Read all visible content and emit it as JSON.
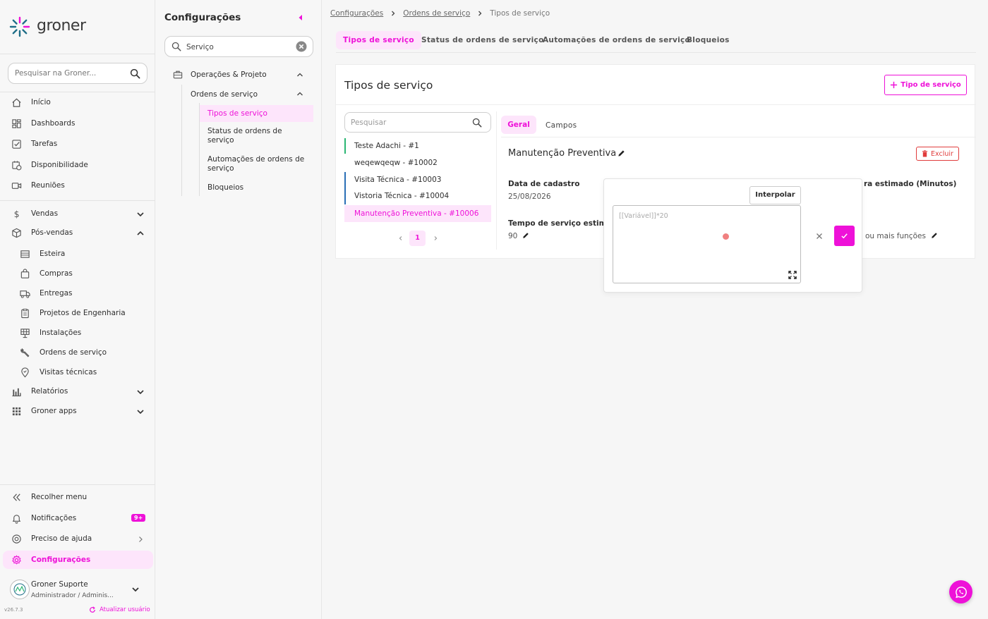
{
  "app": {
    "logo_text": "groner",
    "version": "v26.7.3"
  },
  "colors": {
    "accent": "#ee11d8",
    "accent_light": "#fde5fb",
    "sidebar_bg": "#f7f7f7",
    "danger": "#e03c3c"
  },
  "sidebar": {
    "search_placeholder": "Pesquisar na Groner...",
    "items": [
      {
        "label": "Início",
        "icon": "home-icon"
      },
      {
        "label": "Dashboards",
        "icon": "dashboard-icon"
      },
      {
        "label": "Tarefas",
        "icon": "checkbox-icon"
      },
      {
        "label": "Disponibilidade",
        "icon": "calendar-clock-icon"
      },
      {
        "label": "Reuniões",
        "icon": "video-icon"
      },
      {
        "label": "Vendas",
        "icon": "dollar-icon"
      },
      {
        "label": "Pós-vendas",
        "icon": "box-icon"
      },
      {
        "label": "Esteira",
        "icon": "list-icon"
      },
      {
        "label": "Compras",
        "icon": "shopping-bag-icon"
      },
      {
        "label": "Entregas",
        "icon": "truck-icon"
      },
      {
        "label": "Projetos de Engenharia",
        "icon": "clipboard-icon"
      },
      {
        "label": "Instalações",
        "icon": "solar-panel-icon"
      },
      {
        "label": "Ordens de serviço",
        "icon": "wrench-icon"
      },
      {
        "label": "Visitas técnicas",
        "icon": "location-pin-icon"
      },
      {
        "label": "Relatórios",
        "icon": "bar-chart-icon"
      },
      {
        "label": "Groner apps",
        "icon": "grid-icon"
      }
    ],
    "bottom": {
      "collapse": "Recolher menu",
      "notifications": "Notificações",
      "notifications_badge": "9+",
      "help": "Preciso de ajuda",
      "settings": "Configurações"
    },
    "user": {
      "name": "Groner Suporte",
      "role": "Administrador / Adminis...",
      "update_link": "Atualizar usuário"
    }
  },
  "settings_panel": {
    "title": "Configurações",
    "search_value": "Serviço",
    "tree": {
      "group": "Operações & Projeto",
      "subgroup": "Ordens de serviço",
      "items": [
        "Tipos de serviço",
        "Status de ordens de serviço",
        "Automações de ordens de serviço",
        "Bloqueios"
      ]
    }
  },
  "breadcrumb": [
    "Configurações",
    "Ordens de serviço",
    "Tipos de serviço"
  ],
  "tabs": [
    "Tipos de serviço",
    "Status de ordens de serviço",
    "Automações de ordens de serviço",
    "Bloqueios"
  ],
  "content": {
    "title": "Tipos de serviço",
    "add_button": "Tipo de serviço",
    "list_search_placeholder": "Pesquisar",
    "list": [
      {
        "label": "Teste Adachi - #1",
        "bar": "#2ab673"
      },
      {
        "label": "weqewqeqw - #10002",
        "bar": ""
      },
      {
        "label": "Visita Técnica - #10003",
        "bar": "#2a6fb6"
      },
      {
        "label": "Vistoria Técnica - #10004",
        "bar": "#2a6fb6"
      },
      {
        "label": "Manutenção Preventiva - #10006",
        "bar": ""
      }
    ],
    "pagination": {
      "current": "1"
    },
    "detail_tabs": [
      "Geral",
      "Campos"
    ],
    "detail_title": "Manutenção Preventiva",
    "delete_button": "Excluir",
    "fields": {
      "created_label": "Data de cadastro",
      "created_value": "25/08/2026",
      "estimated_time_label": "Tempo de serviço estimad",
      "estimated_time_value": "90",
      "right_label": "ra estimado (Minutos)",
      "right_value": "ou mais funções"
    },
    "popup": {
      "interpolate_button": "Interpolar",
      "textarea_placeholder": "[[Variável]]*20"
    }
  }
}
